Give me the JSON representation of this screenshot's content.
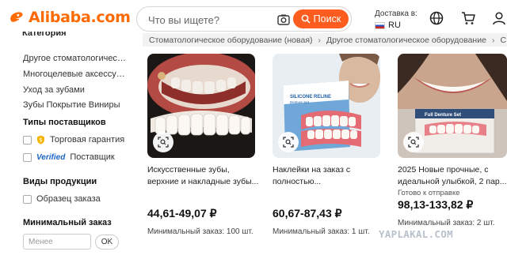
{
  "header": {
    "logo_text": "Alibaba.com",
    "search_placeholder": "Что вы ищете?",
    "search_button": "Поиск",
    "deliver_label": "Доставка в:",
    "country_code": "RU",
    "brand_color": "#ff6a00",
    "icons": [
      "camera-icon",
      "search-icon",
      "globe-icon",
      "cart-icon",
      "user-icon"
    ]
  },
  "sidebar": {
    "category_title": "Категория",
    "categories": [
      "Другое стоматологическ...",
      "Многоцелевые аксессуар...",
      "Уход за зубами",
      "Зубы Покрытие Виниры"
    ],
    "supplier_types_title": "Типы поставщиков",
    "supplier_types": [
      "Торговая гарантия",
      "Поставщик"
    ],
    "verified_label": "Verified",
    "product_types_title": "Виды продукции",
    "product_types": [
      "Образец заказа"
    ],
    "min_order_title": "Минимальный заказ",
    "min_order_placeholder": "Менее",
    "ok_label": "OK"
  },
  "breadcrumb": {
    "items": [
      "Стоматологическое оборудование (новая)",
      "Другое стоматологическое оборудование",
      "С"
    ]
  },
  "products": [
    {
      "title": "Искусственные зубы, верхние и накладные зубы...",
      "tag": "",
      "price": "44,61-49,07 ₽",
      "moq": "Минимальный заказ: 100 шт."
    },
    {
      "title": "Наклейки на заказ с полностью...",
      "tag": "",
      "price": "60,67-87,43 ₽",
      "moq": "Минимальный заказ: 1 шт."
    },
    {
      "title": "2025 Новые прочные, с идеальной улыбкой, 2 пар...",
      "tag": "Готово к отправке",
      "price": "98,13-133,82 ₽",
      "moq": "Минимальный заказ: 2 шт."
    }
  ],
  "product_images": {
    "box_brand": "SILICONE RELINE",
    "box_subtitle": "Denture Set",
    "box2_title": "Full Denture Set"
  },
  "watermark": "YAPLAKAL.COM"
}
